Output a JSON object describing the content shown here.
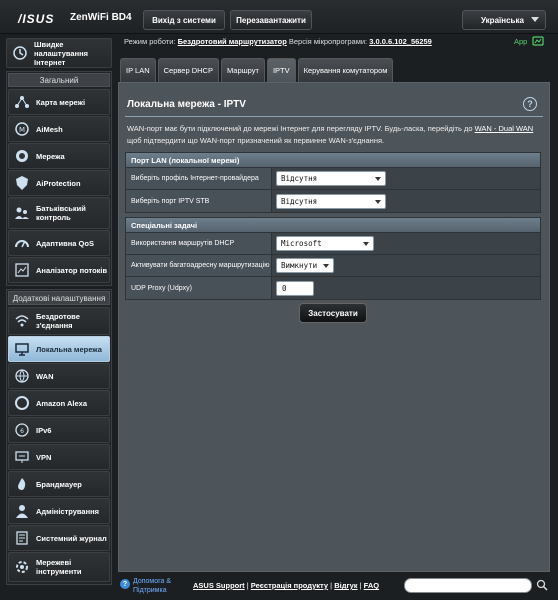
{
  "header": {
    "logo": "/ISUS",
    "model": "ZenWiFi BD4",
    "logout_label": "Вихід з системи",
    "reboot_label": "Перезавантажити",
    "language": "Українська"
  },
  "status": {
    "mode_label": "Режим роботи:",
    "mode_value": "Бездротовий маршрутизатор",
    "fw_label": "Версія мікропрограми:",
    "fw_value": "3.0.0.6.102_56259",
    "app_label": "App"
  },
  "sidebar": {
    "quick": {
      "label": "Швидке налаштування Інтернет",
      "icon": "quick-setup-icon"
    },
    "general_head": "Загальний",
    "general": [
      {
        "label": "Карта мережі",
        "icon": "network-map-icon"
      },
      {
        "label": "AiMesh",
        "icon": "aimesh-icon"
      },
      {
        "label": "Мережа",
        "icon": "guest-network-icon"
      },
      {
        "label": "AiProtection",
        "icon": "aiprotection-icon"
      },
      {
        "label": "Батьківський контроль",
        "icon": "parental-control-icon"
      },
      {
        "label": "Адаптивна QoS",
        "icon": "qos-icon"
      },
      {
        "label": "Аналізатор потоків",
        "icon": "traffic-analyzer-icon"
      }
    ],
    "advanced_head": "Додаткові налаштування",
    "advanced": [
      {
        "label": "Бездротове з'єднання",
        "icon": "wireless-icon"
      },
      {
        "label": "Локальна мережа",
        "icon": "lan-icon"
      },
      {
        "label": "WAN",
        "icon": "wan-icon"
      },
      {
        "label": "Amazon Alexa",
        "icon": "alexa-icon"
      },
      {
        "label": "IPv6",
        "icon": "ipv6-icon"
      },
      {
        "label": "VPN",
        "icon": "vpn-icon"
      },
      {
        "label": "Брандмауер",
        "icon": "firewall-icon"
      },
      {
        "label": "Адміністрування",
        "icon": "administration-icon"
      },
      {
        "label": "Системний журнал",
        "icon": "system-log-icon"
      },
      {
        "label": "Мережеві інструменти",
        "icon": "network-tools-icon"
      }
    ]
  },
  "tabs": [
    "IP LAN",
    "Сервер DHCP",
    "Маршрут",
    "IPTV",
    "Керування комутатором"
  ],
  "main": {
    "title": "Локальна мережа - IPTV",
    "desc_part1": "WAN-порт має бути підключений до мережі Інтернет для перегляду IPTV. Будь-ласка, перейдіть до ",
    "desc_link": "WAN - Dual WAN",
    "desc_part2": " щоб підтвердити що WAN-порт призначений як первинне WAN-з'єднання.",
    "section1": {
      "title": "Порт LAN (локальної мережі)",
      "rows": [
        {
          "label": "Виберіть профіль Інтернет-провайдера",
          "value": "Відсутня"
        },
        {
          "label": "Виберіть порт IPTV STB",
          "value": "Відсутня"
        }
      ]
    },
    "section2": {
      "title": "Спеціальні задачі",
      "rows": [
        {
          "label": "Використання маршрутів DHCP",
          "value": "Microsoft"
        },
        {
          "label": "Активувати багатоадресну маршрутизацію",
          "value": "Вимкнути"
        },
        {
          "label": "UDP Proxy (Udpxy)",
          "value": "0"
        }
      ]
    },
    "apply_label": "Застосувати"
  },
  "footer": {
    "help_label": "Допомога & Підтримка",
    "links": [
      "ASUS Support",
      "Реєстрація продукту",
      "Відгук",
      "FAQ"
    ]
  },
  "colors": {
    "accent": "#8fb8d8",
    "app_green": "#55d06a",
    "link_blue": "#6fb0ff"
  }
}
